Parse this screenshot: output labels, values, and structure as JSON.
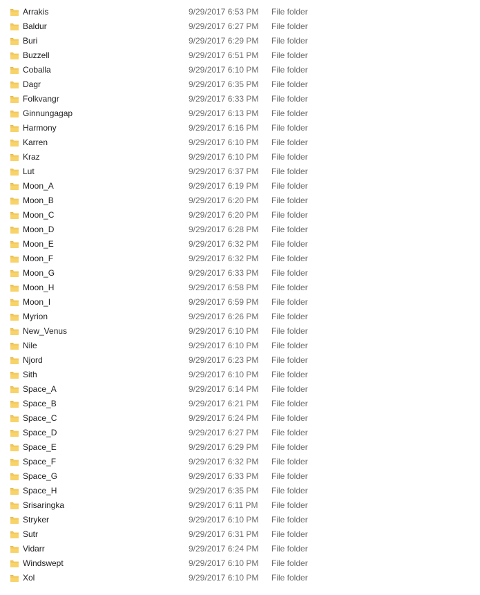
{
  "folder_icon": "folder-icon",
  "colors": {
    "folder_fill": "#f7d36a",
    "folder_tab": "#e6b84a",
    "secondary_text": "#6d6d6d"
  },
  "files": [
    {
      "name": "Arrakis",
      "date": "9/29/2017 6:53 PM",
      "type": "File folder"
    },
    {
      "name": "Baldur",
      "date": "9/29/2017 6:27 PM",
      "type": "File folder"
    },
    {
      "name": "Buri",
      "date": "9/29/2017 6:29 PM",
      "type": "File folder"
    },
    {
      "name": "Buzzell",
      "date": "9/29/2017 6:51 PM",
      "type": "File folder"
    },
    {
      "name": "Coballa",
      "date": "9/29/2017 6:10 PM",
      "type": "File folder"
    },
    {
      "name": "Dagr",
      "date": "9/29/2017 6:35 PM",
      "type": "File folder"
    },
    {
      "name": "Folkvangr",
      "date": "9/29/2017 6:33 PM",
      "type": "File folder"
    },
    {
      "name": "Ginnungagap",
      "date": "9/29/2017 6:13 PM",
      "type": "File folder"
    },
    {
      "name": "Harmony",
      "date": "9/29/2017 6:16 PM",
      "type": "File folder"
    },
    {
      "name": "Karren",
      "date": "9/29/2017 6:10 PM",
      "type": "File folder"
    },
    {
      "name": "Kraz",
      "date": "9/29/2017 6:10 PM",
      "type": "File folder"
    },
    {
      "name": "Lut",
      "date": "9/29/2017 6:37 PM",
      "type": "File folder"
    },
    {
      "name": "Moon_A",
      "date": "9/29/2017 6:19 PM",
      "type": "File folder"
    },
    {
      "name": "Moon_B",
      "date": "9/29/2017 6:20 PM",
      "type": "File folder"
    },
    {
      "name": "Moon_C",
      "date": "9/29/2017 6:20 PM",
      "type": "File folder"
    },
    {
      "name": "Moon_D",
      "date": "9/29/2017 6:28 PM",
      "type": "File folder"
    },
    {
      "name": "Moon_E",
      "date": "9/29/2017 6:32 PM",
      "type": "File folder"
    },
    {
      "name": "Moon_F",
      "date": "9/29/2017 6:32 PM",
      "type": "File folder"
    },
    {
      "name": "Moon_G",
      "date": "9/29/2017 6:33 PM",
      "type": "File folder"
    },
    {
      "name": "Moon_H",
      "date": "9/29/2017 6:58 PM",
      "type": "File folder"
    },
    {
      "name": "Moon_I",
      "date": "9/29/2017 6:59 PM",
      "type": "File folder"
    },
    {
      "name": "Myrion",
      "date": "9/29/2017 6:26 PM",
      "type": "File folder"
    },
    {
      "name": "New_Venus",
      "date": "9/29/2017 6:10 PM",
      "type": "File folder"
    },
    {
      "name": "Nile",
      "date": "9/29/2017 6:10 PM",
      "type": "File folder"
    },
    {
      "name": "Njord",
      "date": "9/29/2017 6:23 PM",
      "type": "File folder"
    },
    {
      "name": "Sith",
      "date": "9/29/2017 6:10 PM",
      "type": "File folder"
    },
    {
      "name": "Space_A",
      "date": "9/29/2017 6:14 PM",
      "type": "File folder"
    },
    {
      "name": "Space_B",
      "date": "9/29/2017 6:21 PM",
      "type": "File folder"
    },
    {
      "name": "Space_C",
      "date": "9/29/2017 6:24 PM",
      "type": "File folder"
    },
    {
      "name": "Space_D",
      "date": "9/29/2017 6:27 PM",
      "type": "File folder"
    },
    {
      "name": "Space_E",
      "date": "9/29/2017 6:29 PM",
      "type": "File folder"
    },
    {
      "name": "Space_F",
      "date": "9/29/2017 6:32 PM",
      "type": "File folder"
    },
    {
      "name": "Space_G",
      "date": "9/29/2017 6:33 PM",
      "type": "File folder"
    },
    {
      "name": "Space_H",
      "date": "9/29/2017 6:35 PM",
      "type": "File folder"
    },
    {
      "name": "Srisaringka",
      "date": "9/29/2017 6:11 PM",
      "type": "File folder"
    },
    {
      "name": "Stryker",
      "date": "9/29/2017 6:10 PM",
      "type": "File folder"
    },
    {
      "name": "Sutr",
      "date": "9/29/2017 6:31 PM",
      "type": "File folder"
    },
    {
      "name": "Vidarr",
      "date": "9/29/2017 6:24 PM",
      "type": "File folder"
    },
    {
      "name": "Windswept",
      "date": "9/29/2017 6:10 PM",
      "type": "File folder"
    },
    {
      "name": "Xol",
      "date": "9/29/2017 6:10 PM",
      "type": "File folder"
    }
  ]
}
